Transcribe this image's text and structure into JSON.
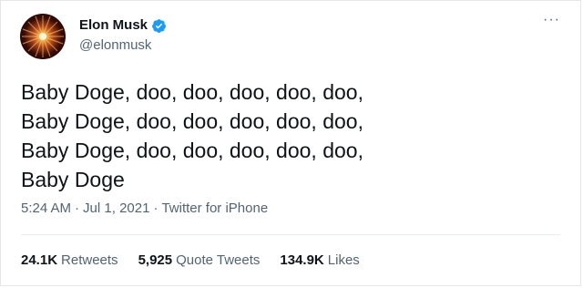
{
  "tweet": {
    "author": {
      "name": "Elon Musk",
      "handle": "@elonmusk",
      "verified": true
    },
    "more_icon": "more-options-icon",
    "text": "Baby Doge, doo, doo, doo, doo, doo,\nBaby Doge, doo, doo, doo, doo, doo,\nBaby Doge, doo, doo, doo, doo, doo,\nBaby Doge",
    "meta": {
      "time": "5:24 AM",
      "date": "Jul 1, 2021",
      "source": "Twitter for iPhone",
      "separator": "·"
    },
    "stats": [
      {
        "count": "24.1K",
        "label": "Retweets"
      },
      {
        "count": "5,925",
        "label": "Quote Tweets"
      },
      {
        "count": "134.9K",
        "label": "Likes"
      }
    ]
  },
  "colors": {
    "verified_blue": "#1d9bf0",
    "secondary_text": "#536471",
    "primary_text": "#0f1419"
  }
}
